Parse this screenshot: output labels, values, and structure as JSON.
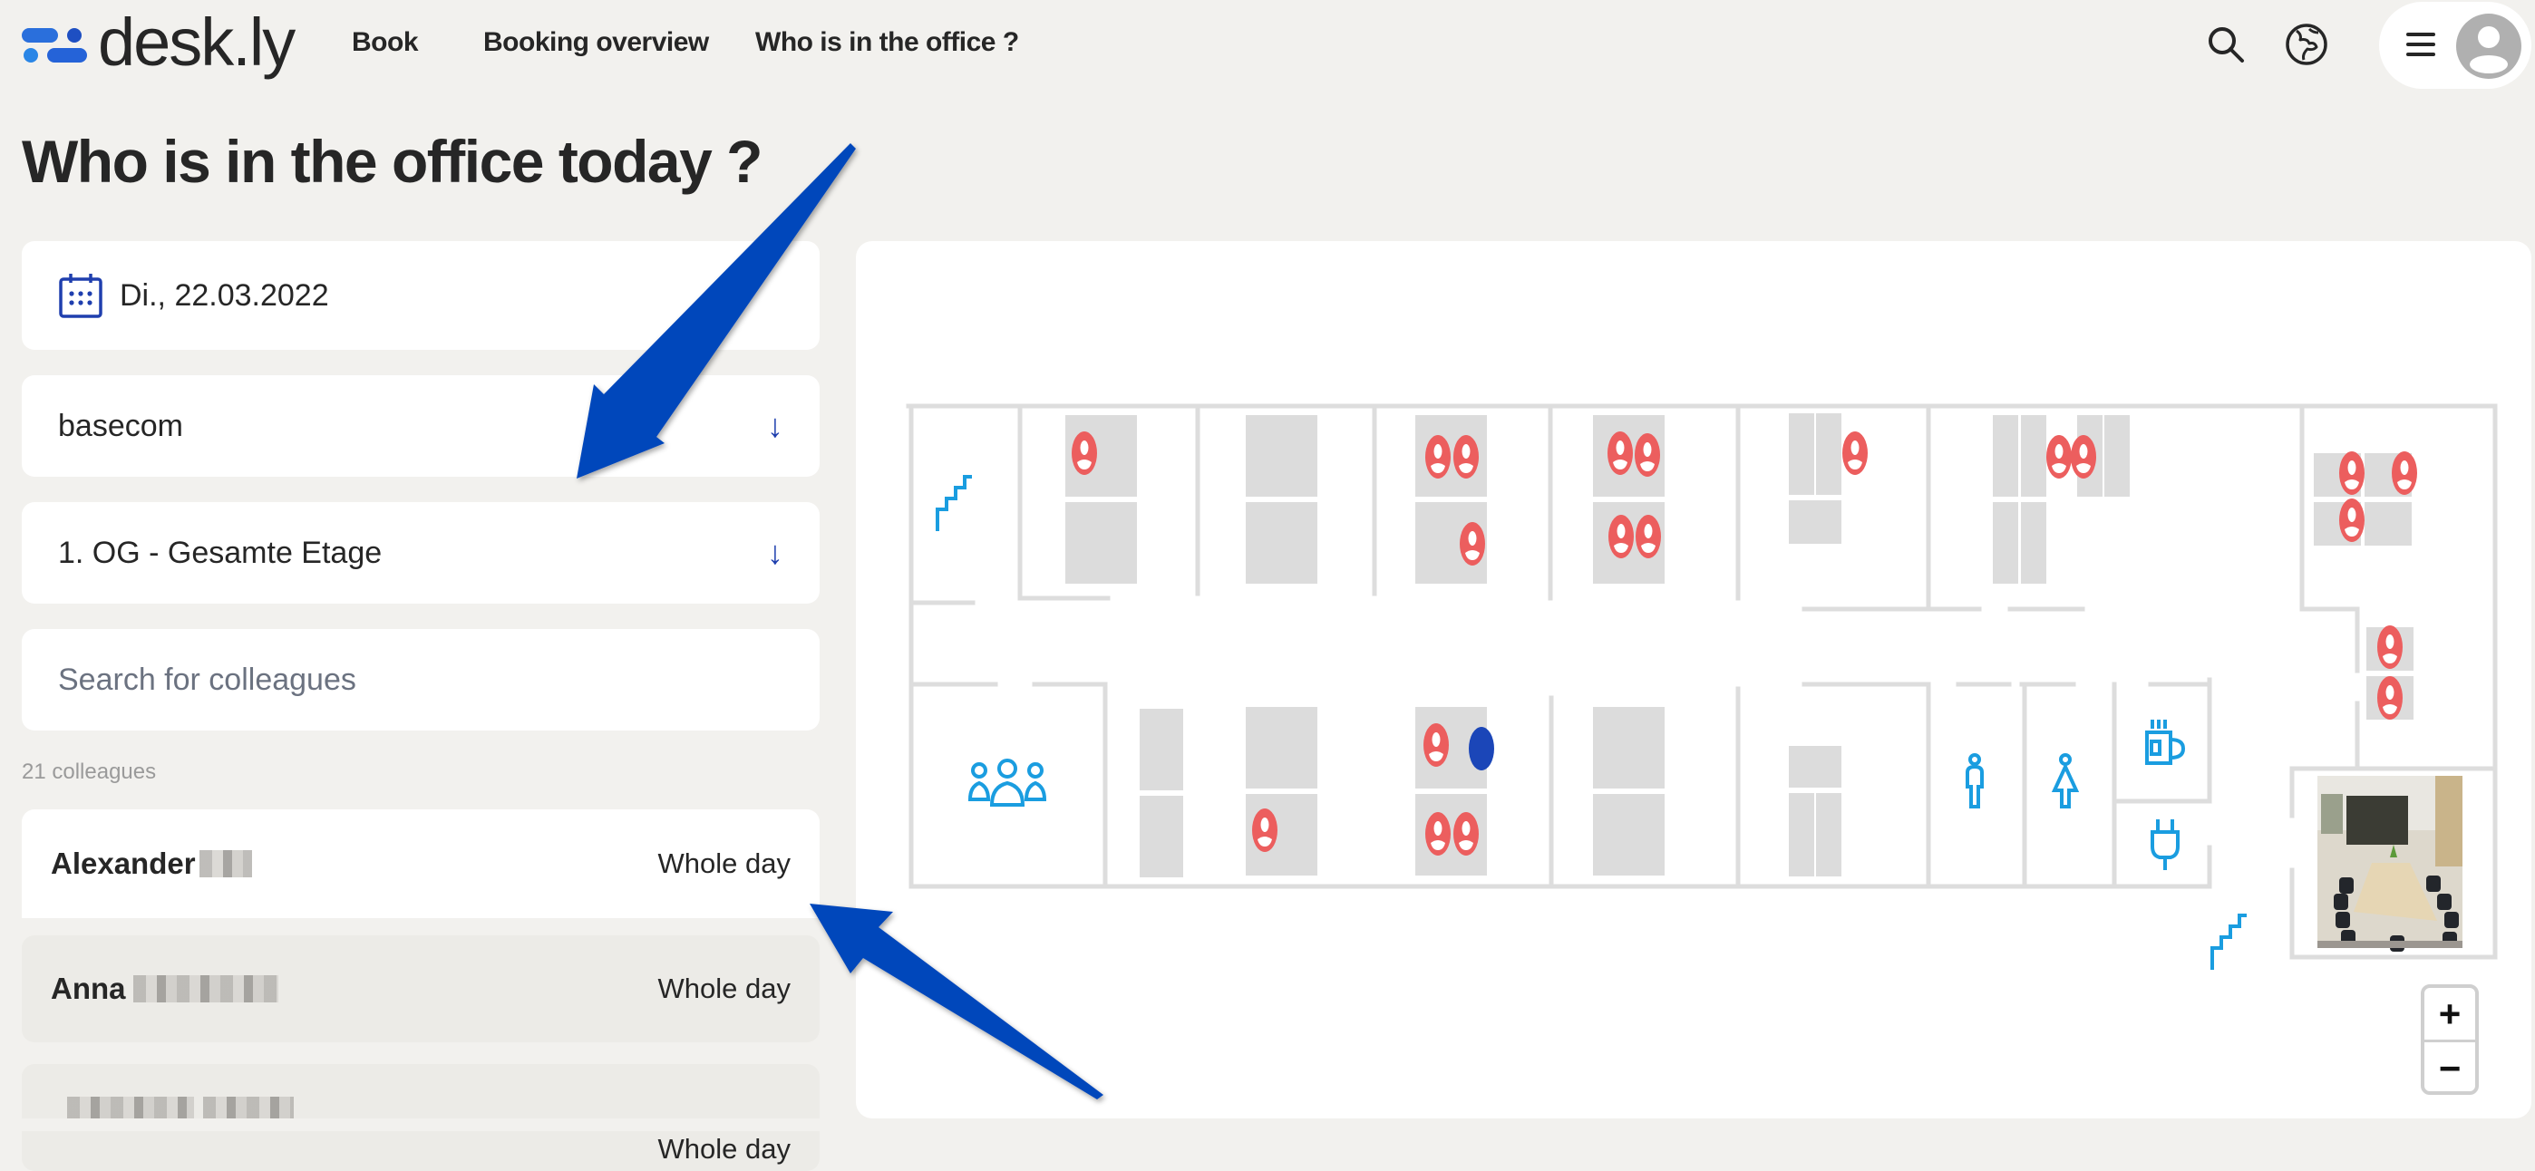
{
  "header": {
    "logo_text": "desk.ly",
    "nav": [
      {
        "label": "Book"
      },
      {
        "label": "Booking overview"
      },
      {
        "label": "Who is in the office ?"
      }
    ],
    "icons": [
      "search-icon",
      "globe-icon",
      "menu-icon",
      "avatar-icon"
    ]
  },
  "page": {
    "title": "Who is in the office today ?"
  },
  "filters": {
    "date": "Di., 22.03.2022",
    "location": "basecom",
    "floor": "1. OG - Gesamte Etage",
    "search_placeholder": "Search for colleagues",
    "dropdown_arrow": "↓"
  },
  "colleagues": {
    "count_label": "21 colleagues",
    "items": [
      {
        "first_name": "Alexander",
        "duration": "Whole day",
        "selected": true
      },
      {
        "first_name": "Anna",
        "duration": "Whole day",
        "selected": false
      },
      {
        "first_name": "",
        "duration": "Whole day",
        "selected": false
      }
    ]
  },
  "map": {
    "colors": {
      "occupied": "#ec5e5e",
      "selected": "#1b46b8",
      "desk": "#dcdcdc",
      "wall": "#dddddd",
      "amenity_icon": "#1a9de0"
    },
    "occupied_seats": 21,
    "selected_seats": 1,
    "amenities": [
      "stairs-icon",
      "meeting-room-icon",
      "toilet-men-icon",
      "toilet-women-icon",
      "kitchen-coffee-icon",
      "power-plug-icon",
      "stairs-icon",
      "conference-room-photo"
    ],
    "zoom_in": "+",
    "zoom_out": "−"
  },
  "annotations": {
    "arrow_color": "#0047bb"
  }
}
